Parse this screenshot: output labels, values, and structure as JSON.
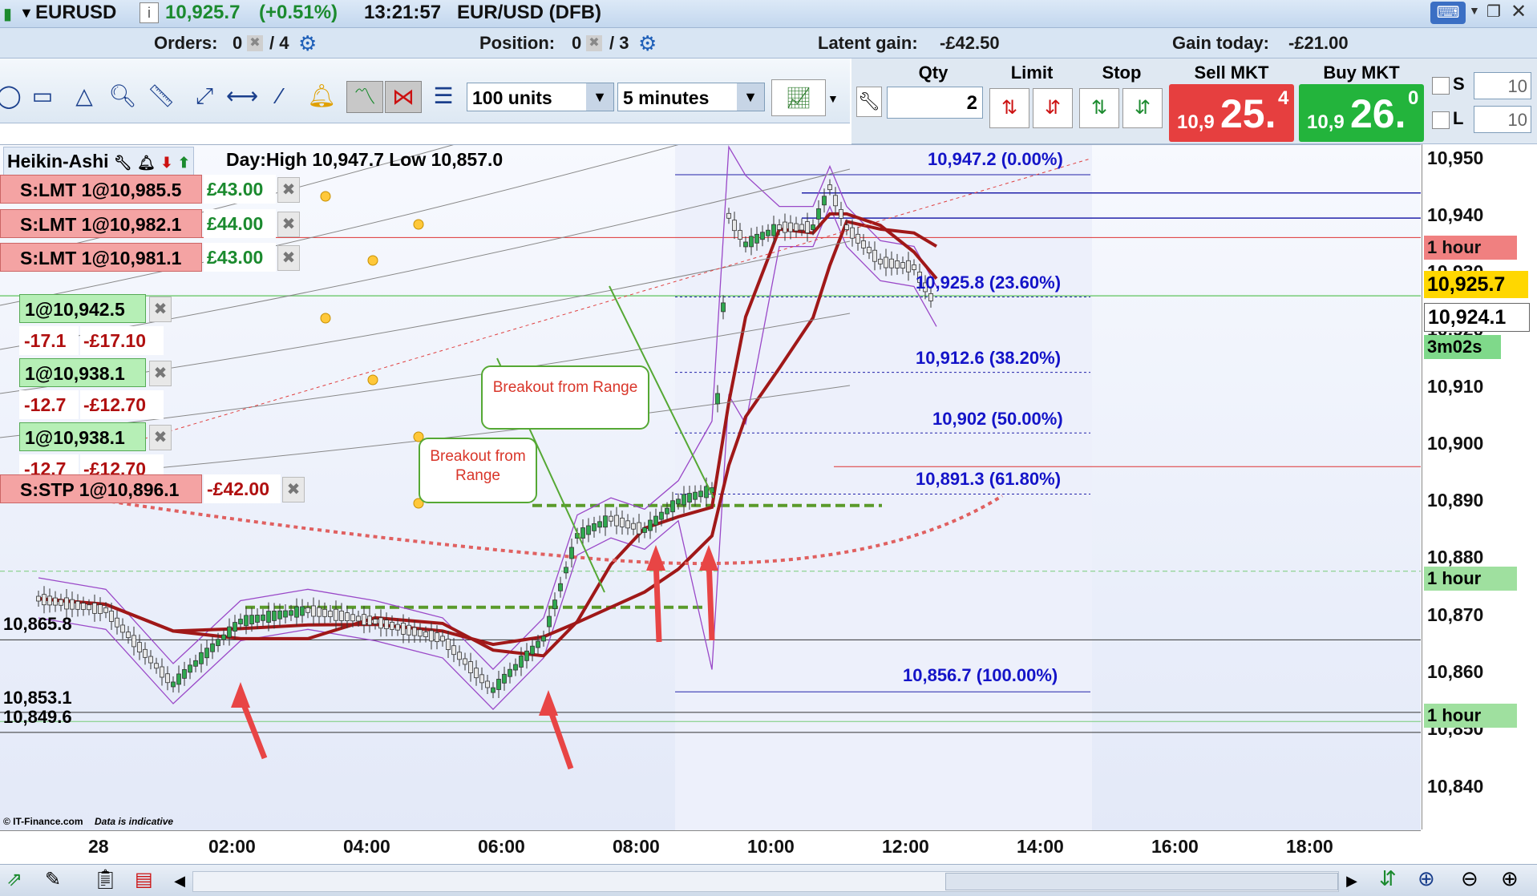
{
  "title": {
    "symbol": "EURUSD",
    "price": "10,925.7",
    "change": "(+0.51%)",
    "time": "13:21:57",
    "description": "EUR/USD (DFB)"
  },
  "info": {
    "orders_label": "Orders:",
    "orders_value": "0",
    "orders_total": "/ 4",
    "position_label": "Position:",
    "position_value": "0",
    "position_total": "/ 3",
    "latent_label": "Latent gain:",
    "latent_value": "-£42.50",
    "gain_label": "Gain today:",
    "gain_value": "-£21.00"
  },
  "toolbar": {
    "units": "100 units",
    "interval": "5 minutes"
  },
  "trade": {
    "qty_label": "Qty",
    "qty_value": "2",
    "limit_label": "Limit",
    "stop_label": "Stop",
    "sell_label": "Sell MKT",
    "buy_label": "Buy MKT",
    "sell_prefix": "10,9",
    "sell_big": "25.",
    "sell_sup": "4",
    "buy_prefix": "10,9",
    "buy_big": "26.",
    "buy_sup": "0",
    "s_label": "S",
    "s_value": "10",
    "l_label": "L",
    "l_value": "10"
  },
  "chart": {
    "indicator": "Heikin-Ashi",
    "day_range": "Day:High 10,947.7 Low 10,857.0",
    "copyright": "© IT-Finance.com",
    "disclaimer": "Data is indicative",
    "orders": [
      {
        "label": "S:LMT 1@10,985.5",
        "pnl": "£43.00"
      },
      {
        "label": "S:LMT 1@10,982.1",
        "pnl": "£44.00"
      },
      {
        "label": "S:LMT 1@10,981.1",
        "pnl": "£43.00"
      }
    ],
    "positions": [
      {
        "label": "1@10,942.5",
        "pts": "-17.1",
        "pnl": "-£17.10"
      },
      {
        "label": "1@10,938.1",
        "pts": "-12.7",
        "pnl": "-£12.70"
      },
      {
        "label": "1@10,938.1",
        "pts": "-12.7",
        "pnl": "-£12.70"
      }
    ],
    "stop": {
      "label": "S:STP 1@10,896.1",
      "pnl": "-£42.00"
    },
    "left_prices": [
      "10,865.8",
      "10,853.1",
      "10,849.6"
    ],
    "fib": [
      {
        "text": "10,947.2 (0.00%)"
      },
      {
        "text": "10,925.8 (23.60%)"
      },
      {
        "text": "10,912.6 (38.20%)"
      },
      {
        "text": "10,902 (50.00%)"
      },
      {
        "text": "10,891.3 (61.80%)"
      },
      {
        "text": "10,856.7 (100.00%)"
      }
    ],
    "callouts": [
      "Breakout from Range",
      "Breakout from Range"
    ],
    "price_labels": [
      "10,950",
      "10,940",
      "10,930",
      "10,920",
      "10,910",
      "10,900",
      "10,890",
      "10,880",
      "10,870",
      "10,860",
      "10,850",
      "10,840"
    ],
    "axis_badges": {
      "last": "10,925.7",
      "cursor": "10,924.1",
      "countdown": "3m02s",
      "hour1": "1 hour",
      "hour2": "1 hour",
      "hour3": "1 hour"
    },
    "time_labels": [
      "28",
      "02:00",
      "04:00",
      "06:00",
      "08:00",
      "10:00",
      "12:00",
      "14:00",
      "16:00",
      "18:00"
    ]
  },
  "chart_data": {
    "type": "line",
    "x": [
      "00:00",
      "01:00",
      "02:00",
      "03:00",
      "04:00",
      "05:00",
      "06:00",
      "06:45",
      "07:30",
      "08:00",
      "08:30",
      "09:00",
      "09:30",
      "10:00",
      "10:15",
      "10:30",
      "11:00",
      "11:30",
      "11:45",
      "12:00",
      "12:30",
      "13:00",
      "13:20"
    ],
    "series": [
      {
        "values": [
          10873,
          10871,
          10858,
          10869,
          10871,
          10869,
          10866,
          10857,
          10866,
          10884,
          10887,
          10885,
          10890,
          10892,
          10940,
          10935,
          10938,
          10938,
          10945,
          10938,
          10932,
          10931,
          10924
        ]
      }
    ],
    "ylim": [
      10835,
      10955
    ],
    "last": 10925.7,
    "day_high": 10947.7,
    "day_low": 10857.0
  }
}
